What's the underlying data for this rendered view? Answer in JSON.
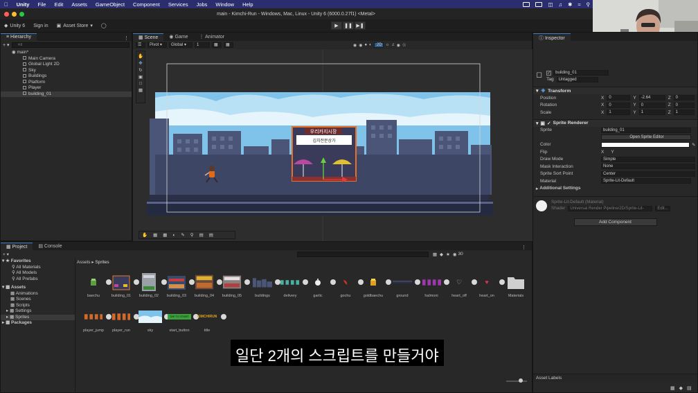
{
  "mac_menu": {
    "app": "Unity",
    "items": [
      "File",
      "Edit",
      "Assets",
      "GameObject",
      "Component",
      "Services",
      "Jobs",
      "Window",
      "Help"
    ]
  },
  "window_title": "main - Kimchi-Run - Windows, Mac, Linux - Unity 6 (6000.0.27f1) <Metal>",
  "toolbar": {
    "account": "Unity 6",
    "sign_in": "Sign in",
    "asset_store": "Asset Store"
  },
  "hierarchy": {
    "tab": "Hierarchy",
    "search_placeholder": "All",
    "scene_name": "main*",
    "items": [
      "Main Camera",
      "Global Light 2D",
      "Sky",
      "Buildings",
      "Platform",
      "Player",
      "building_01"
    ]
  },
  "scene": {
    "tabs": [
      "Scene",
      "Game",
      "Animator"
    ],
    "pivot": "Pivot",
    "global": "Global",
    "step": "1",
    "mode_2d": "2D",
    "sign_title": "우리카지시장",
    "sign_sub": "김치전문상가"
  },
  "inspector": {
    "tab": "Inspector",
    "object_name": "building_01",
    "tag_label": "Tag",
    "tag_value": "Untagged",
    "transform": {
      "title": "Transform",
      "position": {
        "label": "Position",
        "x": "0",
        "y": "-2.64",
        "z": "0"
      },
      "rotation": {
        "label": "Rotation",
        "x": "0",
        "y": "0",
        "z": "0"
      },
      "scale": {
        "label": "Scale",
        "x": "1",
        "y": "1",
        "z": "1"
      }
    },
    "sprite_renderer": {
      "title": "Sprite Renderer",
      "sprite_label": "Sprite",
      "sprite_value": "building_01",
      "open_editor": "Open Sprite Editor",
      "color_label": "Color",
      "flip_label": "Flip",
      "flip_x": "X",
      "flip_y": "Y",
      "draw_mode_label": "Draw Mode",
      "draw_mode_value": "Simple",
      "mask_label": "Mask Interaction",
      "mask_value": "None",
      "sort_point_label": "Sprite Sort Point",
      "sort_point_value": "Center",
      "material_label": "Material",
      "material_value": "Sprite-Lit-Default",
      "additional": "Additional Settings"
    },
    "material_preview": {
      "name": "Sprite-Lit-Default (Material)",
      "shader_label": "Shader",
      "shader_value": "Universal Render Pipeline/2D/Sprite-Lit-",
      "edit": "Edit..."
    },
    "add_component": "Add Component",
    "asset_labels": "Asset Labels"
  },
  "project": {
    "tabs": [
      "Project",
      "Console"
    ],
    "breadcrumb_root": "Assets",
    "breadcrumb_current": "Sprites",
    "count": "30",
    "favorites": {
      "title": "Favorites",
      "items": [
        "All Materials",
        "All Models",
        "All Prefabs"
      ]
    },
    "assets": {
      "title": "Assets",
      "items": [
        "Animations",
        "Scenes",
        "Scripts",
        "Settings",
        "Sprites"
      ]
    },
    "packages": "Packages",
    "row1": [
      "baechu",
      "building_01",
      "building_02",
      "building_03",
      "building_04",
      "building_05",
      "buildings",
      "delivery",
      "garlic",
      "gochu",
      "goldbaechu",
      "ground",
      "halmoni",
      "heart_off",
      "heart_on",
      "Materials"
    ],
    "row2": [
      "player_jump",
      "player_run",
      "sky",
      "start_button",
      "title"
    ],
    "start_button_text": "TAP TO START",
    "title_text": "KIMCHIRUN"
  },
  "subtitle": "일단 2개의 스크립트를 만들거야",
  "colors": {
    "mac_bar": "#2a2d6e",
    "selection_blue": "#3a7dc2",
    "sky": "#7fc3ea",
    "building": "#4a5578"
  }
}
